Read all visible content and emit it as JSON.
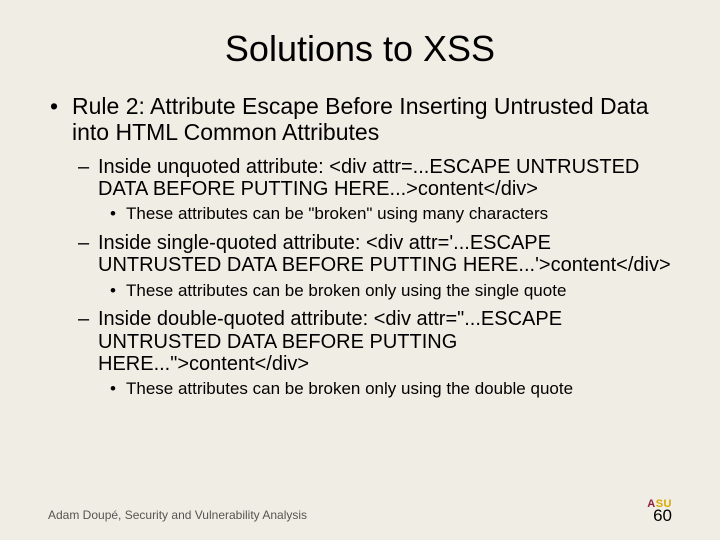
{
  "title": "Solutions to XSS",
  "bullet1": "Rule 2: Attribute Escape Before Inserting Untrusted Data into HTML Common Attributes",
  "sub1": "Inside unquoted attribute: <div attr=...ESCAPE UNTRUSTED DATA BEFORE PUTTING HERE...>content</div>",
  "note1": "These attributes can be \"broken\" using many characters",
  "sub2": "Inside single-quoted attribute: <div attr='...ESCAPE UNTRUSTED DATA BEFORE PUTTING HERE...'>content</div>",
  "note2": "These attributes can be broken only using the single quote",
  "sub3": "Inside double-quoted attribute: <div attr=\"...ESCAPE UNTRUSTED DATA BEFORE PUTTING HERE...\">content</div>",
  "note3": "These attributes can be broken only using the double quote",
  "footer": "Adam Doupé, Security and Vulnerability Analysis",
  "logo_a": "A",
  "logo_su": "SU",
  "page": "60"
}
